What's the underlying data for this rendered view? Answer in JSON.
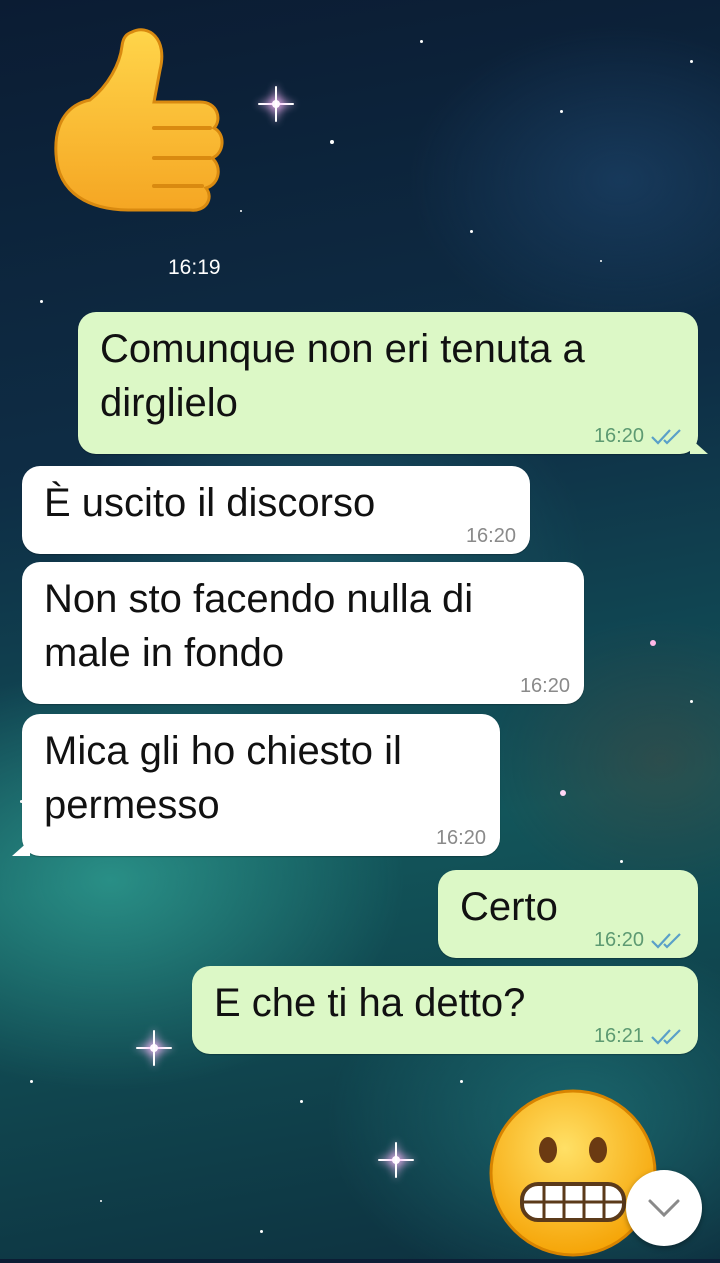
{
  "chat": {
    "sticker_top": {
      "icon": "thumbs-up-icon",
      "time": "16:19"
    },
    "messages": [
      {
        "direction": "out",
        "lines": [
          "Comunque non eri tenuta a",
          "dirglielo"
        ],
        "time": "16:20",
        "read": true
      },
      {
        "direction": "in",
        "lines": [
          "È uscito il discorso"
        ],
        "time": "16:20"
      },
      {
        "direction": "in",
        "lines": [
          "Non sto facendo nulla di",
          "male in fondo"
        ],
        "time": "16:20"
      },
      {
        "direction": "in",
        "lines": [
          "Mica gli ho chiesto il",
          "permesso"
        ],
        "time": "16:20"
      },
      {
        "direction": "out",
        "lines": [
          "Certo"
        ],
        "time": "16:20",
        "read": true
      },
      {
        "direction": "out",
        "lines": [
          "E che ti ha detto?"
        ],
        "time": "16:21",
        "read": true
      }
    ],
    "sticker_bottom": {
      "icon": "grimacing-face-icon"
    },
    "scroll_button": {
      "icon": "chevron-down-icon"
    },
    "colors": {
      "outgoing_bubble": "#dcf8c6",
      "incoming_bubble": "#ffffff",
      "read_ticks": "#4fc3f7"
    }
  }
}
